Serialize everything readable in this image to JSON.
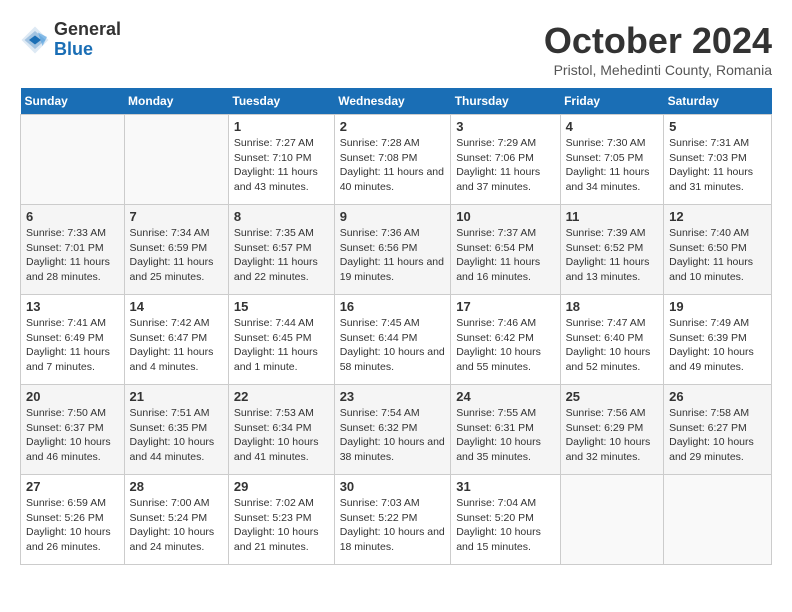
{
  "logo": {
    "general": "General",
    "blue": "Blue"
  },
  "title": "October 2024",
  "location": "Pristol, Mehedinti County, Romania",
  "weekdays": [
    "Sunday",
    "Monday",
    "Tuesday",
    "Wednesday",
    "Thursday",
    "Friday",
    "Saturday"
  ],
  "weeks": [
    [
      {
        "day": "",
        "sunrise": "",
        "sunset": "",
        "daylight": ""
      },
      {
        "day": "",
        "sunrise": "",
        "sunset": "",
        "daylight": ""
      },
      {
        "day": "1",
        "sunrise": "Sunrise: 7:27 AM",
        "sunset": "Sunset: 7:10 PM",
        "daylight": "Daylight: 11 hours and 43 minutes."
      },
      {
        "day": "2",
        "sunrise": "Sunrise: 7:28 AM",
        "sunset": "Sunset: 7:08 PM",
        "daylight": "Daylight: 11 hours and 40 minutes."
      },
      {
        "day": "3",
        "sunrise": "Sunrise: 7:29 AM",
        "sunset": "Sunset: 7:06 PM",
        "daylight": "Daylight: 11 hours and 37 minutes."
      },
      {
        "day": "4",
        "sunrise": "Sunrise: 7:30 AM",
        "sunset": "Sunset: 7:05 PM",
        "daylight": "Daylight: 11 hours and 34 minutes."
      },
      {
        "day": "5",
        "sunrise": "Sunrise: 7:31 AM",
        "sunset": "Sunset: 7:03 PM",
        "daylight": "Daylight: 11 hours and 31 minutes."
      }
    ],
    [
      {
        "day": "6",
        "sunrise": "Sunrise: 7:33 AM",
        "sunset": "Sunset: 7:01 PM",
        "daylight": "Daylight: 11 hours and 28 minutes."
      },
      {
        "day": "7",
        "sunrise": "Sunrise: 7:34 AM",
        "sunset": "Sunset: 6:59 PM",
        "daylight": "Daylight: 11 hours and 25 minutes."
      },
      {
        "day": "8",
        "sunrise": "Sunrise: 7:35 AM",
        "sunset": "Sunset: 6:57 PM",
        "daylight": "Daylight: 11 hours and 22 minutes."
      },
      {
        "day": "9",
        "sunrise": "Sunrise: 7:36 AM",
        "sunset": "Sunset: 6:56 PM",
        "daylight": "Daylight: 11 hours and 19 minutes."
      },
      {
        "day": "10",
        "sunrise": "Sunrise: 7:37 AM",
        "sunset": "Sunset: 6:54 PM",
        "daylight": "Daylight: 11 hours and 16 minutes."
      },
      {
        "day": "11",
        "sunrise": "Sunrise: 7:39 AM",
        "sunset": "Sunset: 6:52 PM",
        "daylight": "Daylight: 11 hours and 13 minutes."
      },
      {
        "day": "12",
        "sunrise": "Sunrise: 7:40 AM",
        "sunset": "Sunset: 6:50 PM",
        "daylight": "Daylight: 11 hours and 10 minutes."
      }
    ],
    [
      {
        "day": "13",
        "sunrise": "Sunrise: 7:41 AM",
        "sunset": "Sunset: 6:49 PM",
        "daylight": "Daylight: 11 hours and 7 minutes."
      },
      {
        "day": "14",
        "sunrise": "Sunrise: 7:42 AM",
        "sunset": "Sunset: 6:47 PM",
        "daylight": "Daylight: 11 hours and 4 minutes."
      },
      {
        "day": "15",
        "sunrise": "Sunrise: 7:44 AM",
        "sunset": "Sunset: 6:45 PM",
        "daylight": "Daylight: 11 hours and 1 minute."
      },
      {
        "day": "16",
        "sunrise": "Sunrise: 7:45 AM",
        "sunset": "Sunset: 6:44 PM",
        "daylight": "Daylight: 10 hours and 58 minutes."
      },
      {
        "day": "17",
        "sunrise": "Sunrise: 7:46 AM",
        "sunset": "Sunset: 6:42 PM",
        "daylight": "Daylight: 10 hours and 55 minutes."
      },
      {
        "day": "18",
        "sunrise": "Sunrise: 7:47 AM",
        "sunset": "Sunset: 6:40 PM",
        "daylight": "Daylight: 10 hours and 52 minutes."
      },
      {
        "day": "19",
        "sunrise": "Sunrise: 7:49 AM",
        "sunset": "Sunset: 6:39 PM",
        "daylight": "Daylight: 10 hours and 49 minutes."
      }
    ],
    [
      {
        "day": "20",
        "sunrise": "Sunrise: 7:50 AM",
        "sunset": "Sunset: 6:37 PM",
        "daylight": "Daylight: 10 hours and 46 minutes."
      },
      {
        "day": "21",
        "sunrise": "Sunrise: 7:51 AM",
        "sunset": "Sunset: 6:35 PM",
        "daylight": "Daylight: 10 hours and 44 minutes."
      },
      {
        "day": "22",
        "sunrise": "Sunrise: 7:53 AM",
        "sunset": "Sunset: 6:34 PM",
        "daylight": "Daylight: 10 hours and 41 minutes."
      },
      {
        "day": "23",
        "sunrise": "Sunrise: 7:54 AM",
        "sunset": "Sunset: 6:32 PM",
        "daylight": "Daylight: 10 hours and 38 minutes."
      },
      {
        "day": "24",
        "sunrise": "Sunrise: 7:55 AM",
        "sunset": "Sunset: 6:31 PM",
        "daylight": "Daylight: 10 hours and 35 minutes."
      },
      {
        "day": "25",
        "sunrise": "Sunrise: 7:56 AM",
        "sunset": "Sunset: 6:29 PM",
        "daylight": "Daylight: 10 hours and 32 minutes."
      },
      {
        "day": "26",
        "sunrise": "Sunrise: 7:58 AM",
        "sunset": "Sunset: 6:27 PM",
        "daylight": "Daylight: 10 hours and 29 minutes."
      }
    ],
    [
      {
        "day": "27",
        "sunrise": "Sunrise: 6:59 AM",
        "sunset": "Sunset: 5:26 PM",
        "daylight": "Daylight: 10 hours and 26 minutes."
      },
      {
        "day": "28",
        "sunrise": "Sunrise: 7:00 AM",
        "sunset": "Sunset: 5:24 PM",
        "daylight": "Daylight: 10 hours and 24 minutes."
      },
      {
        "day": "29",
        "sunrise": "Sunrise: 7:02 AM",
        "sunset": "Sunset: 5:23 PM",
        "daylight": "Daylight: 10 hours and 21 minutes."
      },
      {
        "day": "30",
        "sunrise": "Sunrise: 7:03 AM",
        "sunset": "Sunset: 5:22 PM",
        "daylight": "Daylight: 10 hours and 18 minutes."
      },
      {
        "day": "31",
        "sunrise": "Sunrise: 7:04 AM",
        "sunset": "Sunset: 5:20 PM",
        "daylight": "Daylight: 10 hours and 15 minutes."
      },
      {
        "day": "",
        "sunrise": "",
        "sunset": "",
        "daylight": ""
      },
      {
        "day": "",
        "sunrise": "",
        "sunset": "",
        "daylight": ""
      }
    ]
  ]
}
